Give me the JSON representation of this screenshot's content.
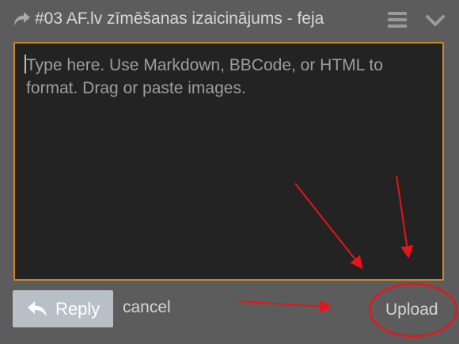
{
  "header": {
    "title": "#03 AF.lv zīmēšanas izaicinājums - feja",
    "reply_icon": "share-arrow-icon",
    "menu_icon": "hamburger-menu-icon",
    "collapse_icon": "chevron-down-icon"
  },
  "editor": {
    "placeholder": "Type here. Use Markdown, BBCode, or HTML to format. Drag or paste images.",
    "value": ""
  },
  "actions": {
    "reply_label": "Reply",
    "reply_icon": "reply-arrow-icon",
    "cancel_label": "cancel",
    "upload_label": "Upload"
  },
  "annotations": {
    "color": "#e8141b",
    "shapes": [
      "arrow",
      "arrow",
      "arrow",
      "circle"
    ]
  },
  "colors": {
    "background": "#5c5c5c",
    "editor_bg": "#232323",
    "editor_border": "#c8892a",
    "button_bg": "#b8bfc6"
  }
}
